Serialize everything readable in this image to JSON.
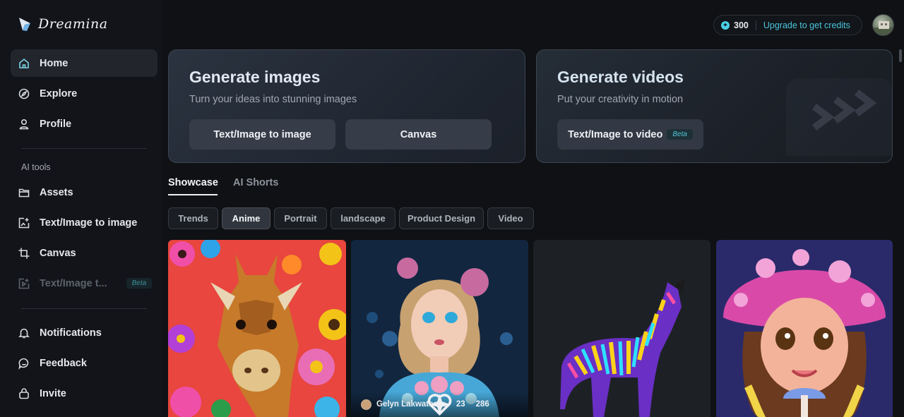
{
  "brand": {
    "name": "Dreamina"
  },
  "topbar": {
    "credits": "300",
    "upgrade_label": "Upgrade to get credits"
  },
  "sidebar": {
    "items": [
      {
        "label": "Home",
        "icon": "home-icon"
      },
      {
        "label": "Explore",
        "icon": "compass-icon"
      },
      {
        "label": "Profile",
        "icon": "user-icon"
      }
    ],
    "section_label": "AI tools",
    "tools": [
      {
        "label": "Assets",
        "icon": "folder-icon"
      },
      {
        "label": "Text/Image to image",
        "icon": "image-edit-icon"
      },
      {
        "label": "Canvas",
        "icon": "crop-icon"
      },
      {
        "label": "Text/Image t...",
        "icon": "video-edit-icon",
        "badge": "Beta"
      }
    ],
    "footer": [
      {
        "label": "Notifications",
        "icon": "bell-icon"
      },
      {
        "label": "Feedback",
        "icon": "chat-icon"
      },
      {
        "label": "Invite",
        "icon": "gift-icon"
      }
    ]
  },
  "hero": {
    "images": {
      "title": "Generate images",
      "subtitle": "Turn your ideas into stunning images",
      "buttons": [
        "Text/Image to image",
        "Canvas"
      ]
    },
    "videos": {
      "title": "Generate videos",
      "subtitle": "Put your creativity in motion",
      "button": "Text/Image to video",
      "badge": "Beta"
    }
  },
  "tabs": [
    "Showcase",
    "AI Shorts"
  ],
  "filters": [
    "Trends",
    "Anime",
    "Portrait",
    "landscape",
    "Product Design",
    "Video"
  ],
  "gallery": {
    "featured": {
      "author": "Gelyn Lakwatsera",
      "likes": "23",
      "remixes": "286"
    }
  },
  "colors": {
    "accent": "#4ac5dc",
    "background": "#0f1114",
    "sidebar": "#121419"
  }
}
